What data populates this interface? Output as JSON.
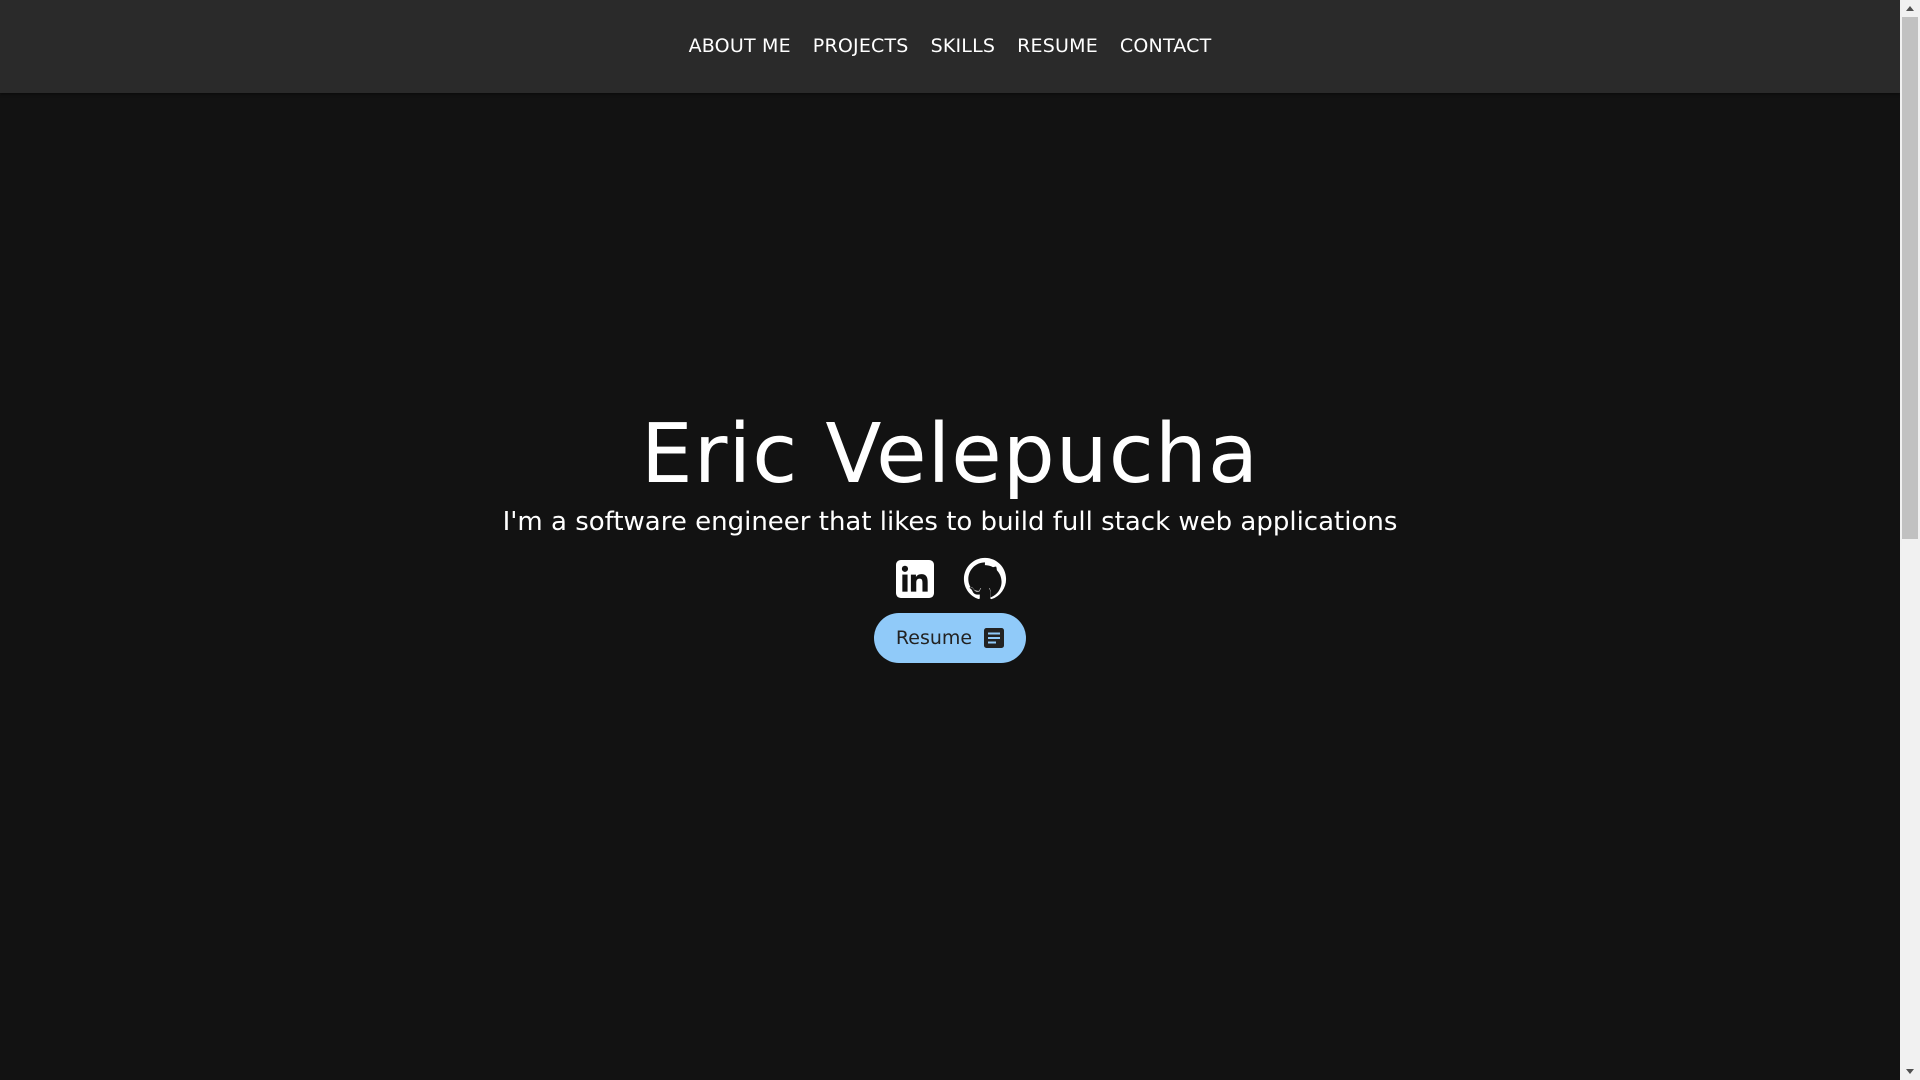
{
  "nav": {
    "items": [
      {
        "label": "ABOUT ME"
      },
      {
        "label": "PROJECTS"
      },
      {
        "label": "SKILLS"
      },
      {
        "label": "RESUME"
      },
      {
        "label": "CONTACT"
      }
    ]
  },
  "hero": {
    "name": "Eric Velepucha",
    "tagline": "I'm a software engineer that likes to build full stack web applications"
  },
  "social": {
    "linkedin_icon": "linkedin-icon",
    "github_icon": "github-icon"
  },
  "resume_button": {
    "label": "Resume",
    "icon": "document-icon"
  },
  "colors": {
    "background": "#121212",
    "navbar": "#2a2a2a",
    "text": "#ffffff",
    "button_bg": "#90caf9",
    "button_text": "#222222"
  }
}
